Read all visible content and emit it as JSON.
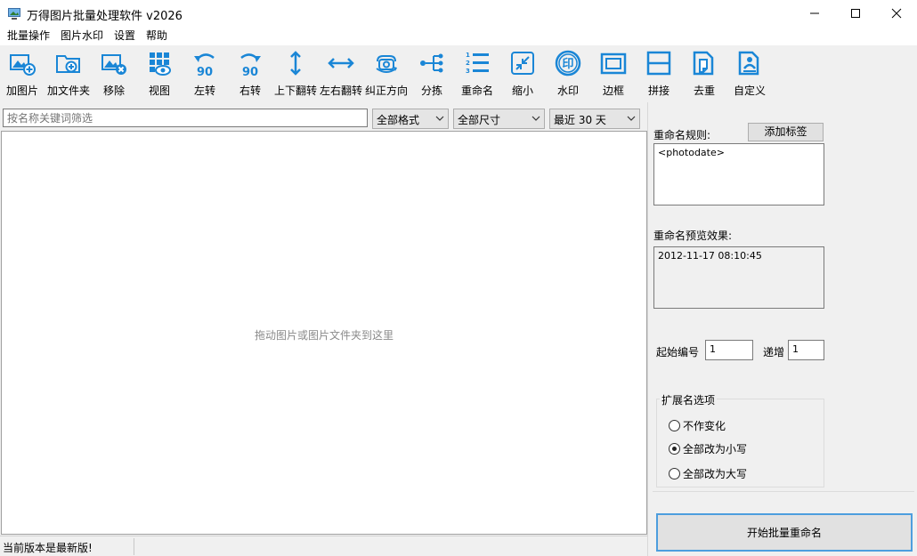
{
  "window": {
    "title": "万得图片批量处理软件 v2026"
  },
  "menu": [
    "批量操作",
    "图片水印",
    "设置",
    "帮助"
  ],
  "toolbar": [
    {
      "label": "加图片",
      "icon": "add-image-icon"
    },
    {
      "label": "加文件夹",
      "icon": "add-folder-icon"
    },
    {
      "label": "移除",
      "icon": "remove-image-icon"
    },
    {
      "label": "视图",
      "icon": "view-grid-icon"
    },
    {
      "label": "左转",
      "icon": "rotate-left-90-icon"
    },
    {
      "label": "右转",
      "icon": "rotate-right-90-icon"
    },
    {
      "label": "上下翻转",
      "icon": "flip-vertical-icon"
    },
    {
      "label": "左右翻转",
      "icon": "flip-horizontal-icon"
    },
    {
      "label": "纠正方向",
      "icon": "auto-orient-icon"
    },
    {
      "label": "分拣",
      "icon": "sort-branch-icon"
    },
    {
      "label": "重命名",
      "icon": "rename-list-icon"
    },
    {
      "label": "缩小",
      "icon": "shrink-icon"
    },
    {
      "label": "水印",
      "icon": "watermark-stamp-icon"
    },
    {
      "label": "边框",
      "icon": "border-frame-icon"
    },
    {
      "label": "拼接",
      "icon": "stitch-icon"
    },
    {
      "label": "去重",
      "icon": "dedupe-icon"
    },
    {
      "label": "自定义",
      "icon": "custom-icon"
    }
  ],
  "filters": {
    "search_placeholder": "按名称关键词筛选",
    "format": "全部格式",
    "size": "全部尺寸",
    "date_range": "最近 30 天"
  },
  "drop_area": {
    "hint": "拖动图片或图片文件夹到这里"
  },
  "status": {
    "message": "当前版本是最新版!"
  },
  "rename_panel": {
    "rule_label": "重命名规则:",
    "add_tag_button": "添加标签",
    "rule_value": "<photodate>",
    "preview_label": "重命名预览效果:",
    "preview_value": "2012-11-17 08:10:45",
    "start_number_label": "起始编号",
    "start_number_value": "1",
    "increment_label": "递增",
    "increment_value": "1",
    "extension_group_title": "扩展名选项",
    "extension_options": [
      {
        "label": "不作变化",
        "selected": false
      },
      {
        "label": "全部改为小写",
        "selected": true
      },
      {
        "label": "全部改为大写",
        "selected": false
      }
    ],
    "start_button": "开始批量重命名"
  },
  "colors": {
    "accent": "#1a86d6",
    "focus_border": "#4d9ede"
  }
}
